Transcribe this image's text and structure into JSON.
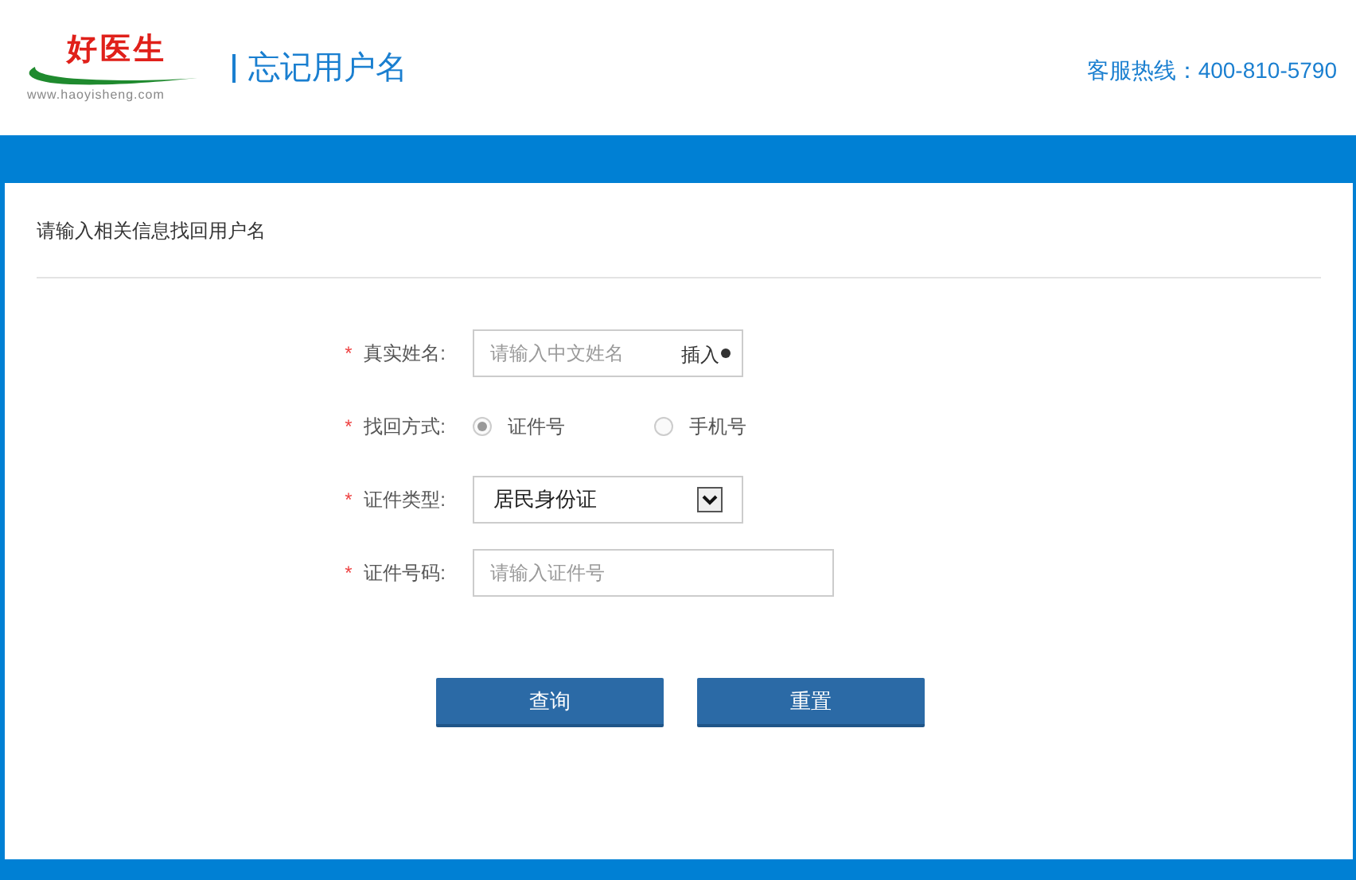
{
  "logo": {
    "name": "好医生",
    "url": "www.haoyisheng.com"
  },
  "page_title": "忘记用户名",
  "hotline": {
    "label": "客服热线：",
    "number": "400-810-5790"
  },
  "panel": {
    "heading": "请输入相关信息找回用户名"
  },
  "form": [
    {
      "kind": "text",
      "mark": "*",
      "label": "真实姓名:",
      "placeholder": "请输入中文姓名",
      "addon": "插入"
    },
    {
      "kind": "radio",
      "mark": "*",
      "label": "找回方式:",
      "options": [
        {
          "label": "证件号",
          "selected": true
        },
        {
          "label": "手机号",
          "selected": false
        }
      ]
    },
    {
      "kind": "select",
      "mark": "*",
      "label": "证件类型:",
      "value": "居民身份证"
    },
    {
      "kind": "text",
      "mark": "*",
      "label": "证件号码:",
      "placeholder": "请输入证件号"
    }
  ],
  "buttons": [
    "查询",
    "重置"
  ]
}
